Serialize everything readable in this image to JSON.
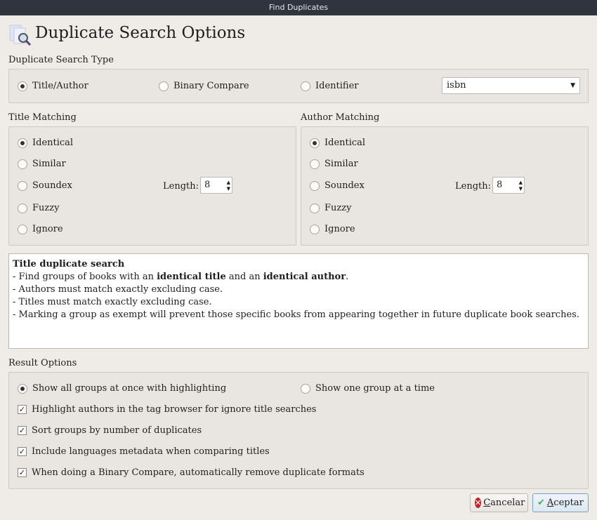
{
  "window_title": "Find Duplicates",
  "heading": "Duplicate Search Options",
  "search_type": {
    "label": "Duplicate Search Type",
    "options": [
      "Title/Author",
      "Binary Compare",
      "Identifier"
    ],
    "selected": "Title/Author",
    "identifier_value": "isbn"
  },
  "title_matching": {
    "label": "Title Matching",
    "options": [
      "Identical",
      "Similar",
      "Soundex",
      "Fuzzy",
      "Ignore"
    ],
    "selected": "Identical",
    "length_label": "Length:",
    "length": "8"
  },
  "author_matching": {
    "label": "Author Matching",
    "options": [
      "Identical",
      "Similar",
      "Soundex",
      "Fuzzy",
      "Ignore"
    ],
    "selected": "Identical",
    "length_label": "Length:",
    "length": "8"
  },
  "description": {
    "title": "Title duplicate search",
    "line1_pre": "- Find groups of books with an ",
    "line1_b1": "identical title",
    "line1_mid": " and an ",
    "line1_b2": "identical author",
    "line1_post": ".",
    "lines": [
      "- Authors must match exactly excluding case.",
      "- Titles must match exactly excluding case.",
      "- Marking a group as exempt will prevent those specific books from appearing together in future duplicate book searches."
    ]
  },
  "result_options": {
    "label": "Result Options",
    "radio": [
      "Show all groups at once with highlighting",
      "Show one group at a time"
    ],
    "checkboxes": [
      "Highlight authors in the tag browser for ignore title searches",
      "Sort groups by number of duplicates",
      "Include languages metadata when comparing titles",
      "When doing a Binary Compare, automatically remove duplicate formats"
    ]
  },
  "buttons": {
    "cancel_first": "C",
    "cancel_rest": "ancelar",
    "ok_first": "A",
    "ok_rest": "ceptar"
  }
}
